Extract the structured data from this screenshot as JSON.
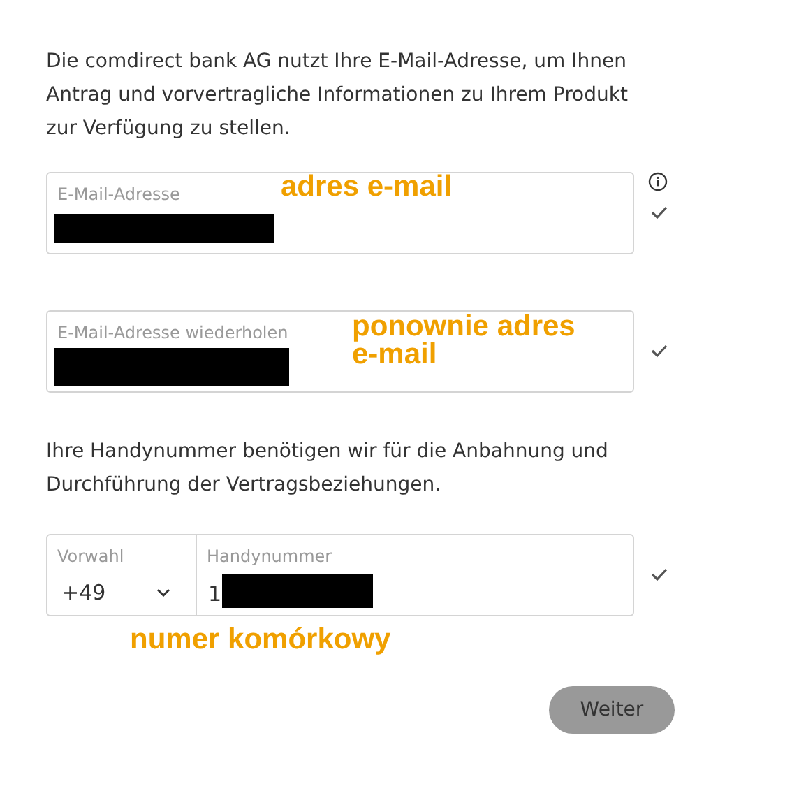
{
  "intro": "Die comdirect bank AG nutzt Ihre E-Mail-Adresse, um Ihnen Antrag und vorvertragliche Informationen zu Ihrem Produkt zur Verfügung zu stellen.",
  "email_fields": [
    {
      "label": "E-Mail-Adresse",
      "redacted": true,
      "info": true,
      "valid": true,
      "annotation": "adres e-mail"
    },
    {
      "label": "E-Mail-Adresse wiederholen",
      "redacted": true,
      "info": false,
      "valid": true,
      "annotation": "ponownie adres e-mail"
    }
  ],
  "phone_intro": "Ihre Handynummer benötigen wir für die Anbahnung und Durchführung der Vertragsbeziehungen.",
  "phone": {
    "prefix_label": "Vorwahl",
    "prefix_value": "+49",
    "number_label": "Handynummer",
    "number_value": "1",
    "redacted": true,
    "valid": true,
    "annotation": "numer komórkowy"
  },
  "next_button": {
    "label": "Weiter",
    "disabled": true
  }
}
